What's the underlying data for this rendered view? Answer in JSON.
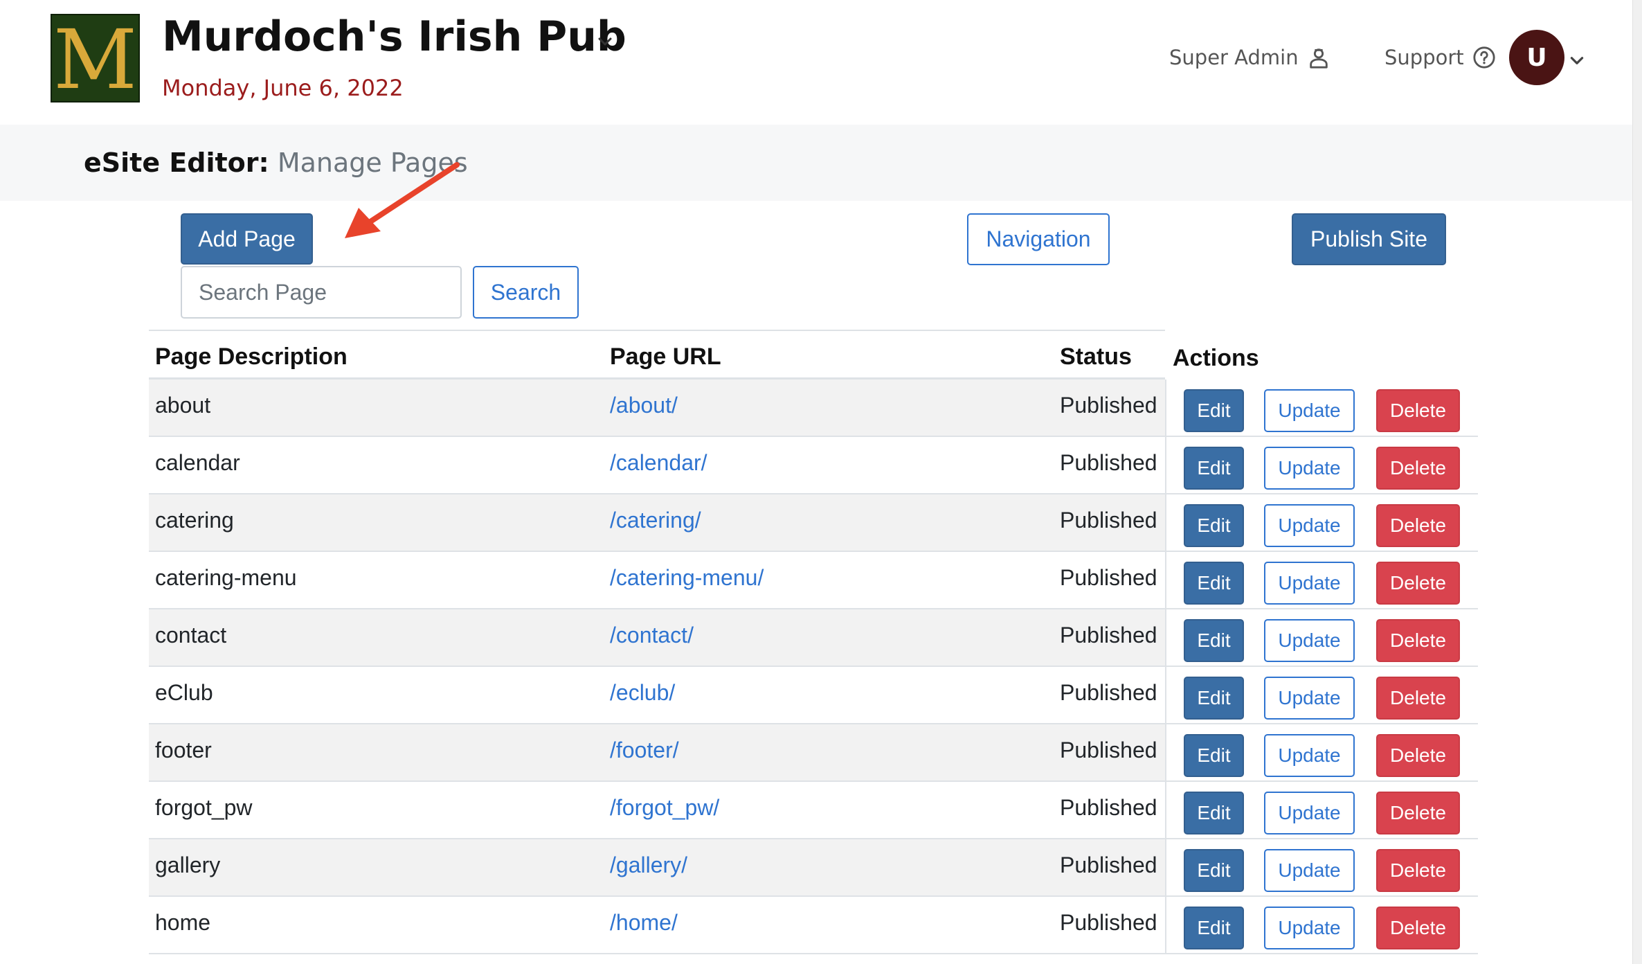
{
  "header": {
    "logo_letter": "M",
    "business_name": "Murdoch's Irish Pub",
    "date": "Monday, June 6, 2022",
    "super_admin_label": "Super Admin",
    "support_label": "Support",
    "avatar_initial": "U"
  },
  "page": {
    "title_lead": "eSite Editor:",
    "title_sub": "Manage Pages"
  },
  "toolbar": {
    "add_page_label": "Add Page",
    "navigation_label": "Navigation",
    "publish_label": "Publish Site",
    "search_placeholder": "Search Page",
    "search_label": "Search"
  },
  "table": {
    "headers": {
      "description": "Page Description",
      "url": "Page URL",
      "status": "Status",
      "actions": "Actions"
    },
    "action_labels": {
      "edit": "Edit",
      "update": "Update",
      "delete": "Delete"
    },
    "rows": [
      {
        "description": "about",
        "url": "/about/",
        "status": "Published"
      },
      {
        "description": "calendar",
        "url": "/calendar/",
        "status": "Published"
      },
      {
        "description": "catering",
        "url": "/catering/",
        "status": "Published"
      },
      {
        "description": "catering-menu",
        "url": "/catering-menu/",
        "status": "Published"
      },
      {
        "description": "contact",
        "url": "/contact/",
        "status": "Published"
      },
      {
        "description": "eClub",
        "url": "/eclub/",
        "status": "Published"
      },
      {
        "description": "footer",
        "url": "/footer/",
        "status": "Published"
      },
      {
        "description": "forgot_pw",
        "url": "/forgot_pw/",
        "status": "Published"
      },
      {
        "description": "gallery",
        "url": "/gallery/",
        "status": "Published"
      },
      {
        "description": "home",
        "url": "/home/",
        "status": "Published"
      }
    ]
  },
  "icons": {
    "business_caret": "chevron-down-icon",
    "super_admin": "user-shield-icon",
    "support": "question-circle-icon",
    "avatar_caret": "chevron-down-icon",
    "annotation": "red-arrow-icon"
  },
  "colors": {
    "primary": "#3a6ea5",
    "link": "#2f74d0",
    "danger": "#d9434e",
    "date": "#9b1c1c",
    "logo_bg": "#1f3d13",
    "logo_letter": "#d9a93a",
    "avatar_bg": "#4a1414",
    "arrow": "#e8432b"
  }
}
